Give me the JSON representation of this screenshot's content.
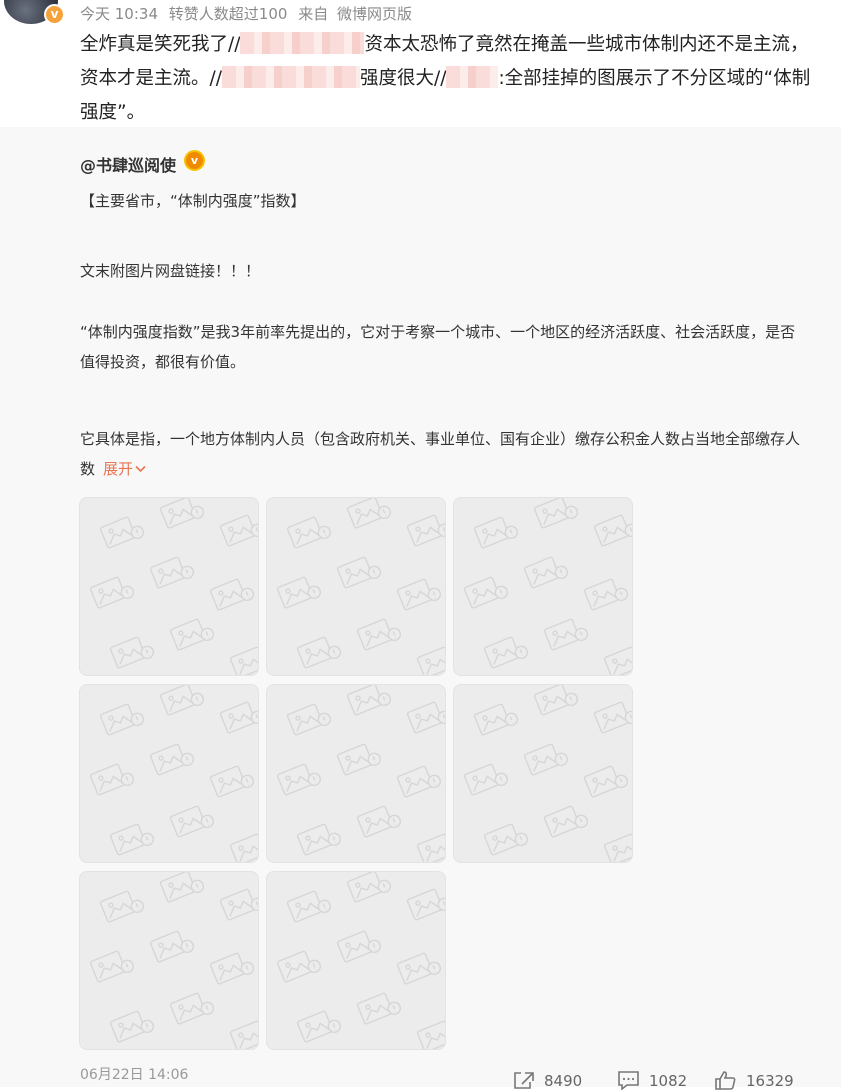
{
  "post": {
    "time": "今天 10:34",
    "like_hint": "转赞人数超过100",
    "source_prefix": "来自",
    "source": "微博网页版",
    "text_parts": [
      "全炸真是笑死我了//",
      "资本太恐怖了竟然在掩盖一些城市体制内还不是主流，资本才是主流。//",
      "强度很大//",
      ":全部挂掉的图展示了不分区域的“体制强度”。"
    ]
  },
  "repost": {
    "author": "@书肆巡阅使",
    "line1": "【主要省市，“体制内强度”指数】",
    "line2": "文末附图片网盘链接！！！",
    "para1": "“体制内强度指数”是我3年前率先提出的，它对于考察一个城市、一个地区的经济活跃度、社会活跃度，是否值得投资，都很有价值。",
    "para2": "它具体是指，一个地方体制内人员（包含政府机关、事业单位、国有企业）缴存公积金人数占当地全部缴存人数",
    "expand": "展开",
    "image_count": 8
  },
  "footer": {
    "date": "06月22日 14:06",
    "reposts": "8490",
    "comments": "1082",
    "likes": "16329"
  },
  "colors": {
    "link_orange": "#eb7350",
    "repost_bg": "#f8f8f8",
    "tile_bg": "#ececec"
  },
  "icons": [
    "avatar-verified-icon",
    "verified-v-icon",
    "broken-image-icon",
    "repost-icon",
    "comment-icon",
    "like-icon",
    "chevron-down-icon"
  ]
}
